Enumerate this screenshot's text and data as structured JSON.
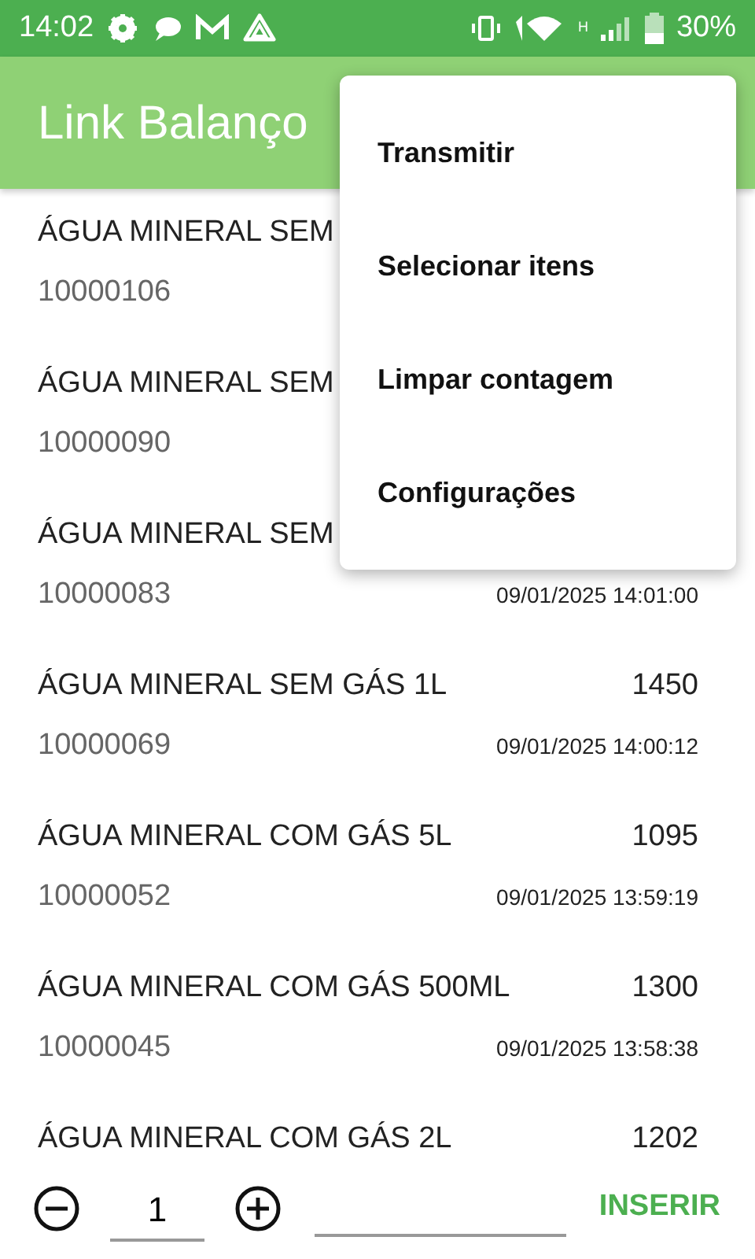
{
  "status_bar": {
    "time": "14:02",
    "network_type": "H",
    "battery": "30%"
  },
  "app_bar": {
    "title": "Link Balanço"
  },
  "items": [
    {
      "name": "ÁGUA MINERAL SEM",
      "code": "10000106"
    },
    {
      "name": "ÁGUA MINERAL SEM",
      "code": "10000090"
    },
    {
      "name": "ÁGUA MINERAL SEM",
      "code": "10000083",
      "date": "09/01/2025 14:01:00"
    },
    {
      "name": "ÁGUA MINERAL SEM GÁS 1L",
      "code": "10000069",
      "count": "1450",
      "date": "09/01/2025 14:00:12"
    },
    {
      "name": "ÁGUA MINERAL COM GÁS 5L",
      "code": "10000052",
      "count": "1095",
      "date": "09/01/2025 13:59:19"
    },
    {
      "name": "ÁGUA MINERAL COM GÁS 500ML",
      "code": "10000045",
      "count": "1300",
      "date": "09/01/2025 13:58:38"
    },
    {
      "name": "ÁGUA MINERAL COM GÁS 2L",
      "count": "1202"
    }
  ],
  "menu": [
    "Transmitir",
    "Selecionar itens",
    "Limpar contagem",
    "Configurações"
  ],
  "bottom_bar": {
    "quantity": "1",
    "insert_button": "INSERIR"
  }
}
